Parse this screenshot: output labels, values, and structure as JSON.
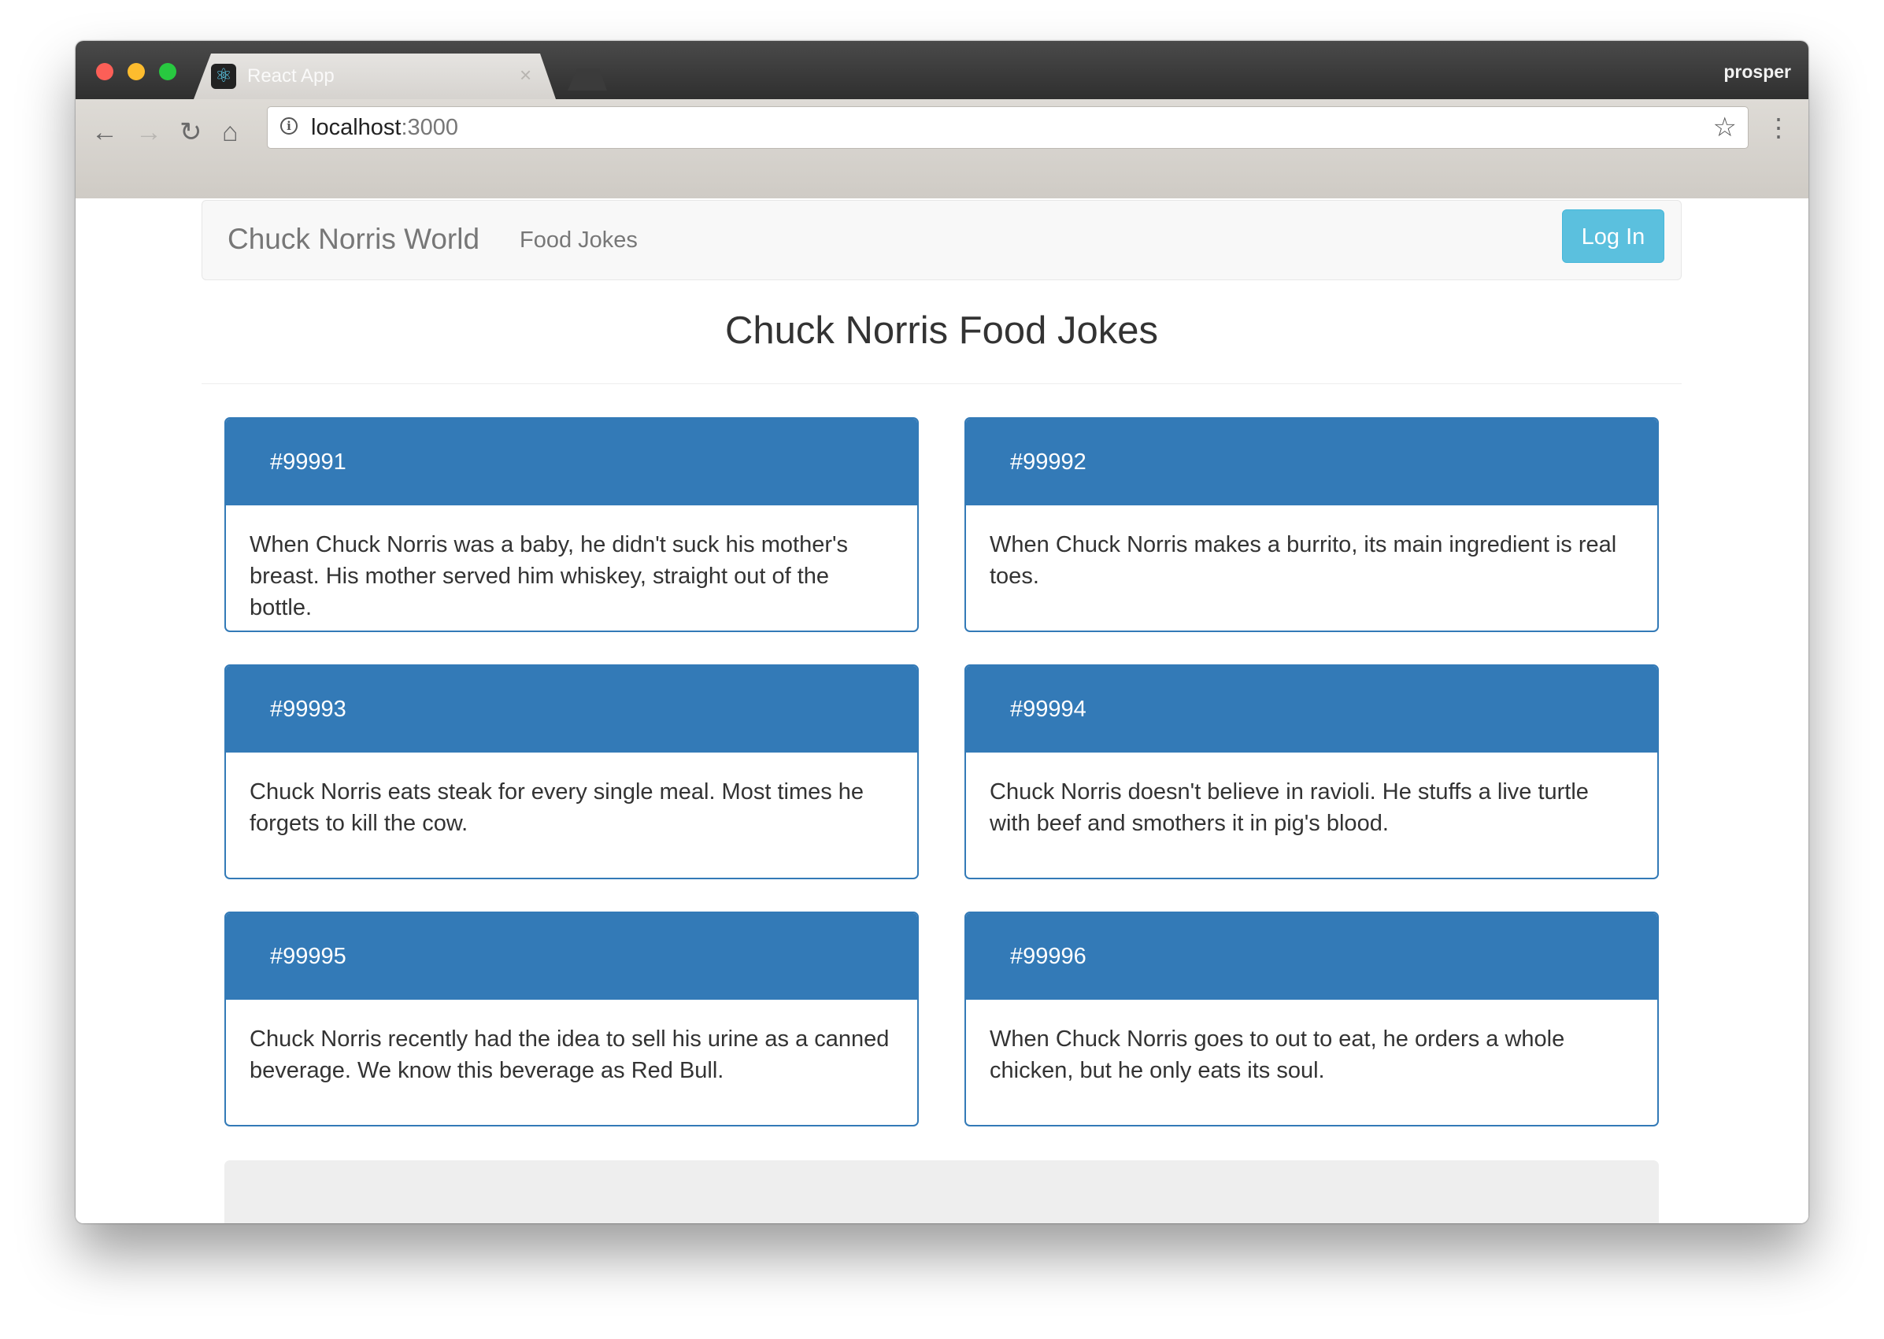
{
  "browser": {
    "tab_title": "React App",
    "tab_close": "×",
    "profile_name": "prosper",
    "url_host": "localhost",
    "url_port": ":3000"
  },
  "navbar": {
    "brand": "Chuck Norris World",
    "link_food_jokes": "Food Jokes",
    "login_label": "Log In"
  },
  "page": {
    "title": "Chuck Norris Food Jokes"
  },
  "jokes": [
    {
      "id": "#99991",
      "text": "When Chuck Norris was a baby, he didn't suck his mother's breast. His mother served him whiskey, straight out of the bottle."
    },
    {
      "id": "#99992",
      "text": "When Chuck Norris makes a burrito, its main ingredient is real toes."
    },
    {
      "id": "#99993",
      "text": "Chuck Norris eats steak for every single meal. Most times he forgets to kill the cow."
    },
    {
      "id": "#99994",
      "text": "Chuck Norris doesn't believe in ravioli. He stuffs a live turtle with beef and smothers it in pig's blood."
    },
    {
      "id": "#99995",
      "text": "Chuck Norris recently had the idea to sell his urine as a canned beverage. We know this beverage as Red Bull."
    },
    {
      "id": "#99996",
      "text": "When Chuck Norris goes to out to eat, he orders a whole chicken, but he only eats its soul."
    }
  ],
  "colors": {
    "primary": "#337ab7",
    "info_button": "#5bc0de",
    "well": "#eeeeee"
  },
  "icons": [
    "back-arrow-icon",
    "forward-arrow-icon",
    "reload-icon",
    "home-icon",
    "info-icon",
    "star-icon",
    "menu-dots-icon",
    "react-icon"
  ]
}
